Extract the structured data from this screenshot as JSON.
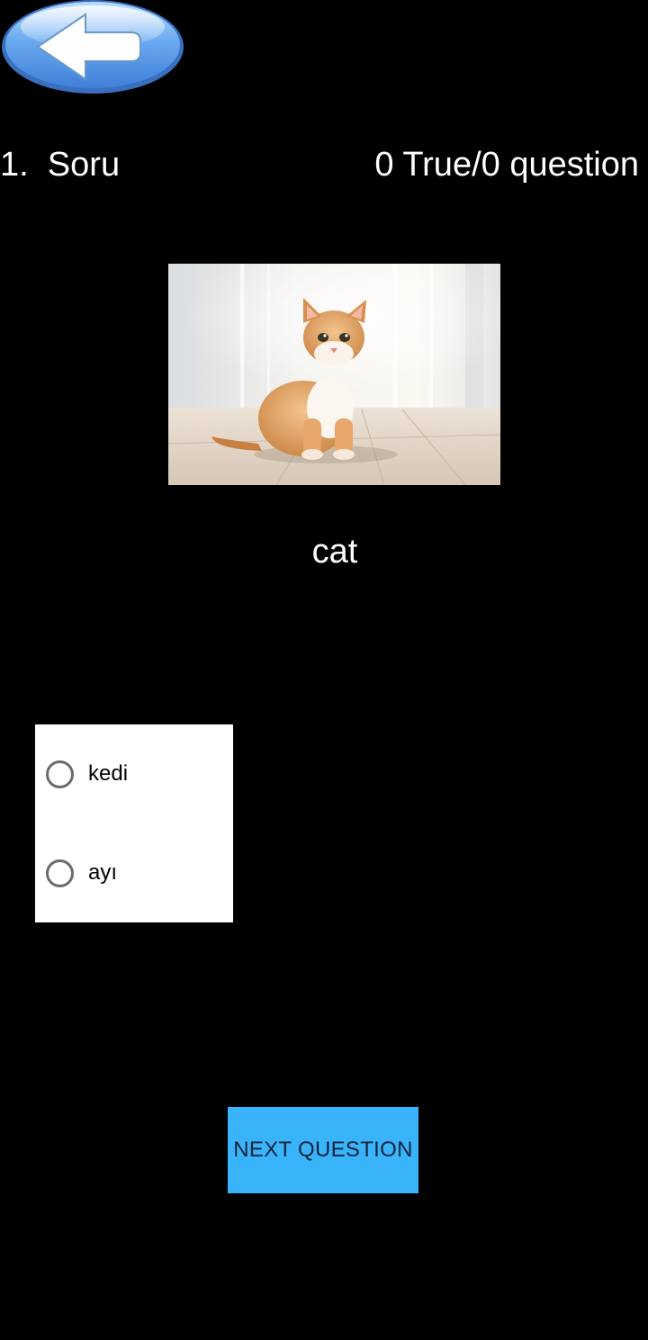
{
  "header": {
    "question_number": "1.  Soru",
    "score": "0 True/0 question"
  },
  "question": {
    "word": "cat",
    "image_icon": "cat-photo"
  },
  "options": [
    {
      "label": "kedi",
      "selected": false
    },
    {
      "label": "ayı",
      "selected": false
    }
  ],
  "actions": {
    "next_label": "NEXT QUESTION"
  },
  "colors": {
    "background": "#000000",
    "next_button": "#39b4fb",
    "back_button": "#5a9fe6",
    "options_background": "#ffffff"
  }
}
